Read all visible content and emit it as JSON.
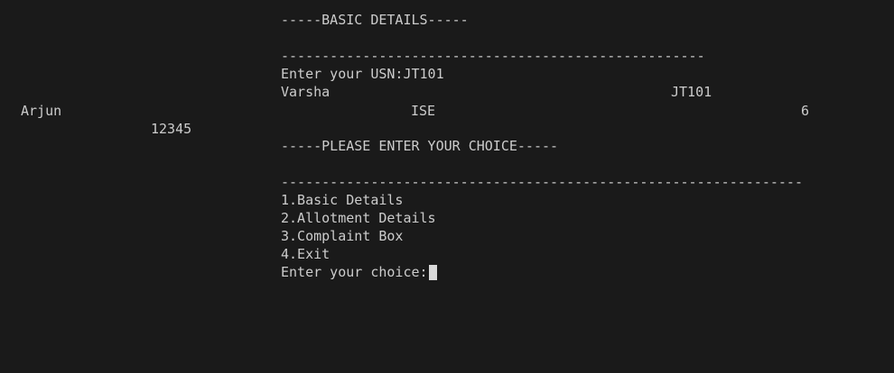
{
  "terminal": {
    "basic_header": "-----BASIC DETAILS-----",
    "separator_short": "----------------------------------------------------",
    "usn_prompt": "Enter your USN:JT101",
    "record": {
      "col1": "Varsha",
      "col2": "JT101",
      "name": "Arjun",
      "branch": "ISE",
      "semester": "6",
      "phone": "12345"
    },
    "choice_header": "-----PLEASE ENTER YOUR CHOICE-----",
    "separator_long": "----------------------------------------------------------------",
    "menu": [
      "1.Basic Details",
      "2.Allotment Details",
      "3.Complaint Box",
      "4.Exit"
    ],
    "choice_prompt": "Enter your choice:"
  }
}
